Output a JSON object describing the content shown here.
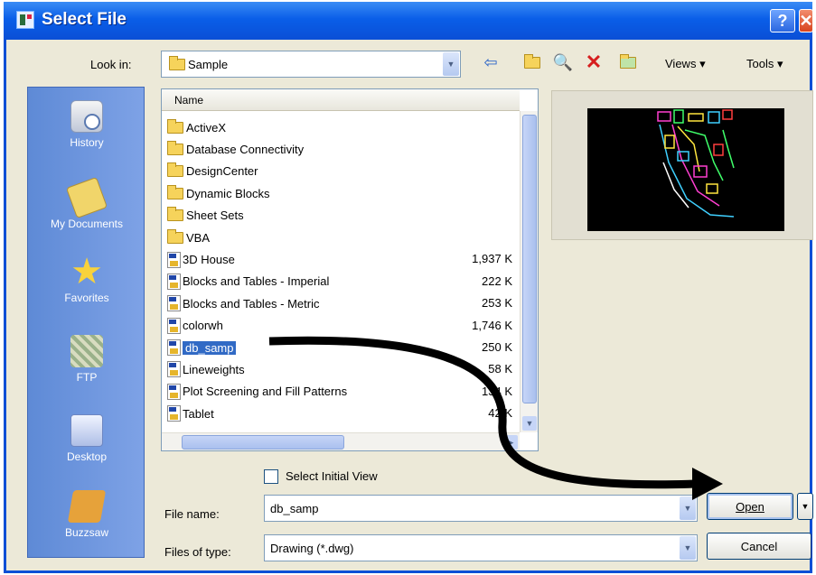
{
  "window": {
    "title": "Select File",
    "help_glyph": "?",
    "close_glyph": "✕"
  },
  "lookin": {
    "label": "Look in:",
    "value": "Sample"
  },
  "toolbar": {
    "views_label": "Views",
    "tools_label": "Tools",
    "menu_arrow": "▾"
  },
  "places": [
    {
      "label": "History",
      "icon": "history-icon"
    },
    {
      "label": "My Documents",
      "icon": "my-documents-icon"
    },
    {
      "label": "Favorites",
      "icon": "favorites-icon"
    },
    {
      "label": "FTP",
      "icon": "ftp-icon"
    },
    {
      "label": "Desktop",
      "icon": "desktop-icon"
    },
    {
      "label": "Buzzsaw",
      "icon": "buzzsaw-icon"
    }
  ],
  "filelist": {
    "column_name": "Name",
    "items": [
      {
        "name": "ActiveX",
        "type": "folder",
        "size": ""
      },
      {
        "name": "Database Connectivity",
        "type": "folder",
        "size": ""
      },
      {
        "name": "DesignCenter",
        "type": "folder",
        "size": ""
      },
      {
        "name": "Dynamic Blocks",
        "type": "folder",
        "size": ""
      },
      {
        "name": "Sheet Sets",
        "type": "folder",
        "size": ""
      },
      {
        "name": "VBA",
        "type": "folder",
        "size": ""
      },
      {
        "name": "3D House",
        "type": "dwg",
        "size": "1,937 K"
      },
      {
        "name": "Blocks and Tables - Imperial",
        "type": "dwg",
        "size": "222 K"
      },
      {
        "name": "Blocks and Tables - Metric",
        "type": "dwg",
        "size": "253 K"
      },
      {
        "name": "colorwh",
        "type": "dwg",
        "size": "1,746 K"
      },
      {
        "name": "db_samp",
        "type": "dwg",
        "size": "250 K",
        "selected": true
      },
      {
        "name": "Lineweights",
        "type": "dwg",
        "size": "58 K"
      },
      {
        "name": "Plot Screening and Fill Patterns",
        "type": "dwg",
        "size": "134 K"
      },
      {
        "name": "Tablet",
        "type": "dwg",
        "size": "42 K"
      }
    ]
  },
  "select_initial_view": "Select Initial View",
  "file_name": {
    "label": "File name:",
    "value": "db_samp"
  },
  "files_of_type": {
    "label": "Files of type:",
    "value": "Drawing (*.dwg)"
  },
  "buttons": {
    "open": "Open",
    "cancel": "Cancel"
  }
}
